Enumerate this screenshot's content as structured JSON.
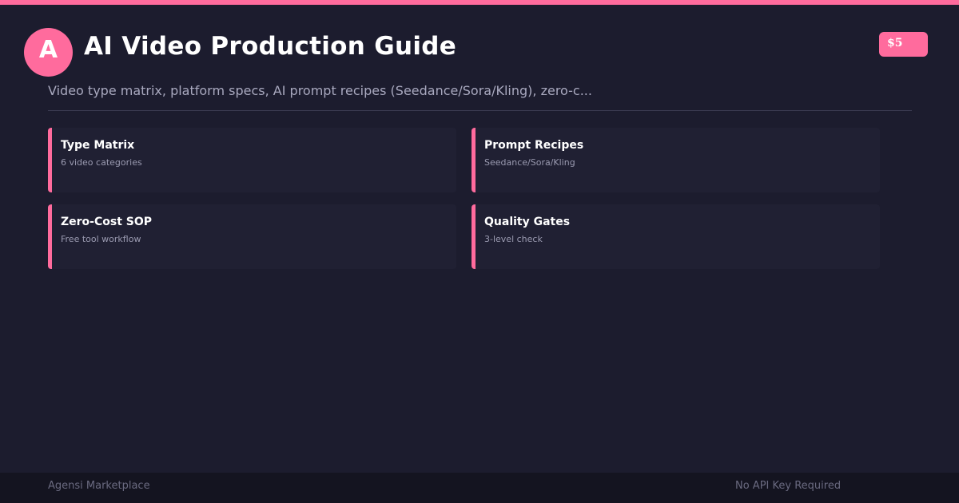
{
  "header": {
    "avatar_letter": "A",
    "title": "AI Video Production Guide",
    "price": "$5",
    "subtitle": "Video type matrix, platform specs, AI prompt recipes (Seedance/Sora/Kling), zero-c..."
  },
  "cards": [
    {
      "title": "Type Matrix",
      "desc": "6 video categories"
    },
    {
      "title": "Prompt Recipes",
      "desc": "Seedance/Sora/Kling"
    },
    {
      "title": "Zero-Cost SOP",
      "desc": "Free tool workflow"
    },
    {
      "title": "Quality Gates",
      "desc": "3-level check"
    }
  ],
  "footer": {
    "left": "Agensi Marketplace",
    "right": "No API Key Required"
  },
  "colors": {
    "accent": "#ff6b9d",
    "background": "#1c1c2e",
    "card": "#202033",
    "footer": "#141420"
  }
}
